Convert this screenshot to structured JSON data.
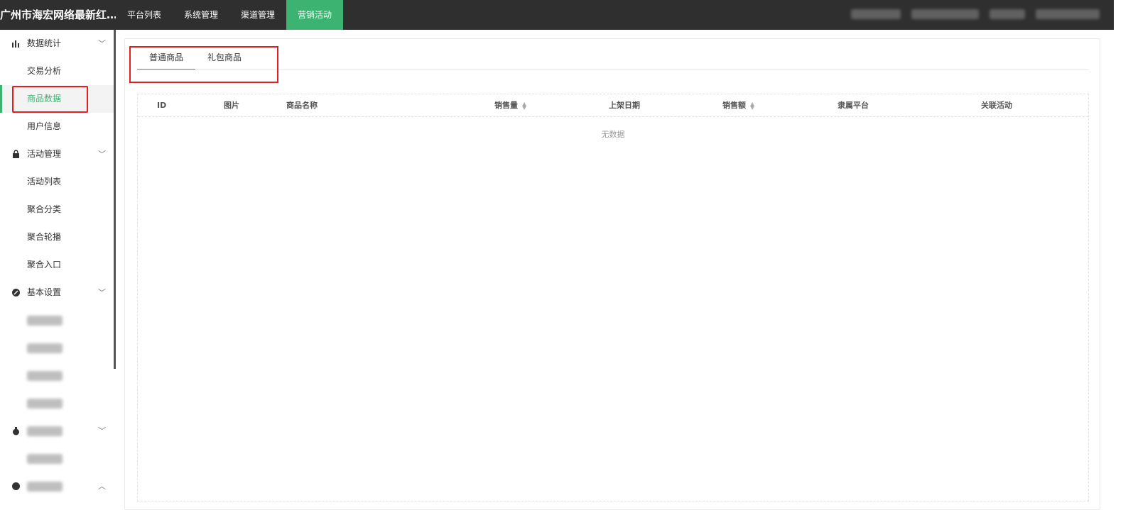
{
  "header": {
    "brand": "广州市海宏网络最新红…",
    "nav": [
      "平台列表",
      "系统管理",
      "渠道管理",
      "营销活动"
    ],
    "active_nav": "营销活动"
  },
  "sidebar": {
    "groups": [
      {
        "label": "数据统计",
        "icon": "bar-chart-icon",
        "items": [
          "交易分析",
          "商品数据",
          "用户信息"
        ]
      },
      {
        "label": "活动管理",
        "icon": "gift-bag-icon",
        "items": [
          "活动列表",
          "聚合分类",
          "聚合轮播",
          "聚合入口"
        ]
      },
      {
        "label": "基本设置",
        "icon": "settings-icon",
        "items": []
      }
    ],
    "active_item": "商品数据"
  },
  "tabs": [
    "普通商品",
    "礼包商品"
  ],
  "active_tab": "普通商品",
  "table": {
    "columns": [
      "ID",
      "图片",
      "商品名称",
      "销售量",
      "上架日期",
      "销售额",
      "隶属平台",
      "关联活动"
    ],
    "sortable": [
      "销售量",
      "销售额"
    ],
    "empty_text": "无数据"
  },
  "colors": {
    "accent": "#3cb371",
    "topbar": "#2f2f2f",
    "highlight_box": "#e02020"
  }
}
